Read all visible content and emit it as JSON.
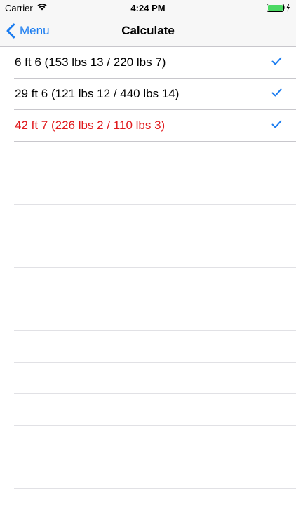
{
  "status_bar": {
    "carrier": "Carrier",
    "time": "4:24 PM",
    "wifi_icon": "wifi-icon",
    "battery_icon": "battery-charging-icon"
  },
  "nav": {
    "back_label": "Menu",
    "back_icon": "chevron-left-icon",
    "title": "Calculate",
    "accent_color": "#1a7cf0"
  },
  "rows": [
    {
      "label": "6 ft 6 (153 lbs 13 / 220 lbs 7)",
      "checked": true,
      "highlight": false
    },
    {
      "label": "29 ft 6 (121 lbs 12 / 440 lbs 14)",
      "checked": true,
      "highlight": false
    },
    {
      "label": "42 ft 7 (226 lbs 2 / 110 lbs 3)",
      "checked": true,
      "highlight": true
    }
  ],
  "colors": {
    "highlight_text": "#e0191c",
    "checkmark": "#1a7cf0",
    "separator": "#c8c7cc"
  }
}
